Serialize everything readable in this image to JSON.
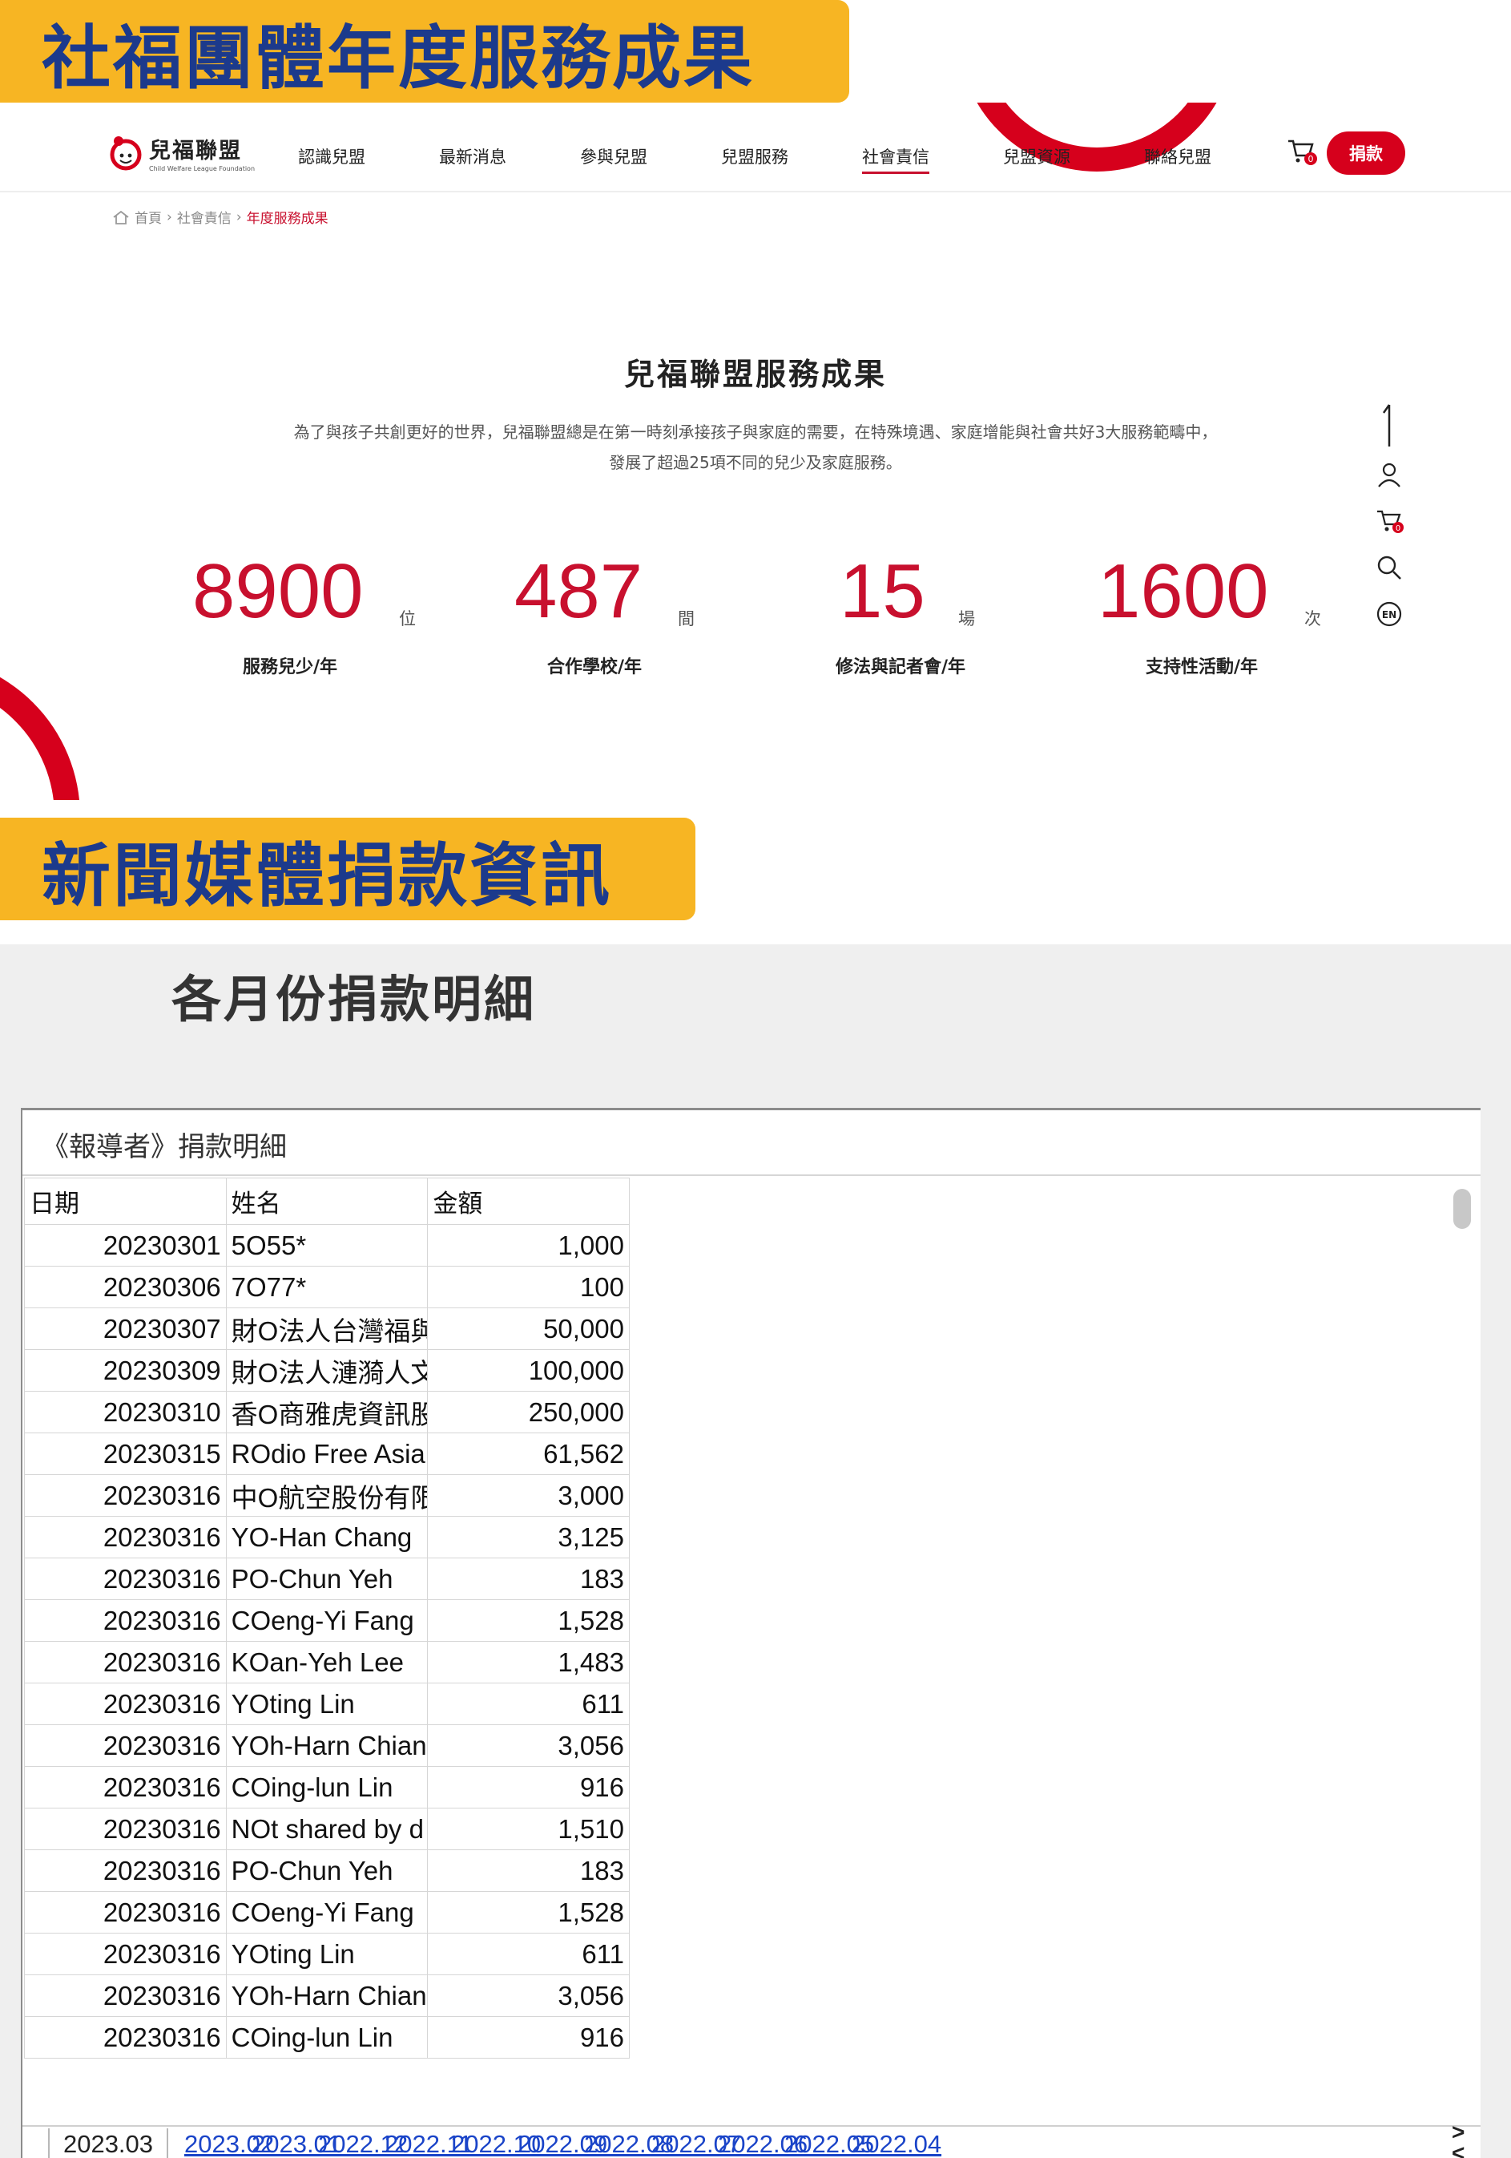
{
  "banners": {
    "top": "社福團體年度服務成果",
    "middle": "新聞媒體捐款資訊"
  },
  "site": {
    "logo": {
      "name": "兒福聯盟",
      "subtitle": "Child Welfare League Foundation"
    },
    "nav": [
      "認識兒盟",
      "最新消息",
      "參與兒盟",
      "兒盟服務",
      "社會責信",
      "兒盟資源",
      "聯絡兒盟"
    ],
    "nav_active": "社會責信",
    "cart_count": "0",
    "donate_label": "捐款",
    "breadcrumb": {
      "home": "首頁",
      "parent": "社會責信",
      "current": "年度服務成果",
      "separator": "›"
    },
    "section_title": "兒福聯盟服務成果",
    "section_desc_line1": "為了與孩子共創更好的世界，兒福聯盟總是在第一時刻承接孩子與家庭的需要，在特殊境遇、家庭增能與社會共好3大服務範疇中，",
    "section_desc_line2": "發展了超過25項不同的兒少及家庭服務。",
    "stats": [
      {
        "value": "8900",
        "unit": "位",
        "label": "服務兒少/年"
      },
      {
        "value": "487",
        "unit": "間",
        "label": "合作學校/年"
      },
      {
        "value": "15",
        "unit": "場",
        "label": "修法與記者會/年"
      },
      {
        "value": "1600",
        "unit": "次",
        "label": "支持性活動/年"
      }
    ],
    "side_icons": [
      "arrow-up-icon",
      "user-icon",
      "cart-icon",
      "search-icon",
      "language-en-icon"
    ],
    "side_cart_count": "0",
    "lang_label": "EN"
  },
  "spreadsheet": {
    "heading": "各月份捐款明細",
    "title": "《報導者》捐款明細",
    "columns": [
      "日期",
      "姓名",
      "金額"
    ],
    "rows": [
      [
        "20230301",
        "5O55*",
        "1,000"
      ],
      [
        "20230306",
        "7O77*",
        "100"
      ],
      [
        "20230307",
        "財O法人台灣福與",
        "50,000"
      ],
      [
        "20230309",
        "財O法人漣漪人文",
        "100,000"
      ],
      [
        "20230310",
        "香O商雅虎資訊股",
        "250,000"
      ],
      [
        "20230315",
        "ROdio Free Asia",
        "61,562"
      ],
      [
        "20230316",
        "中O航空股份有限",
        "3,000"
      ],
      [
        "20230316",
        "YO-Han Chang",
        "3,125"
      ],
      [
        "20230316",
        "PO-Chun Yeh",
        "183"
      ],
      [
        "20230316",
        "COeng-Yi Fang",
        "1,528"
      ],
      [
        "20230316",
        "KOan-Yeh Lee",
        "1,483"
      ],
      [
        "20230316",
        "YOting Lin",
        "611"
      ],
      [
        "20230316",
        "YOh-Harn Chiang",
        "3,056"
      ],
      [
        "20230316",
        "COing-lun Lin",
        "916"
      ],
      [
        "20230316",
        "NOt shared by d",
        "1,510"
      ],
      [
        "20230316",
        "PO-Chun Yeh",
        "183"
      ],
      [
        "20230316",
        "COeng-Yi Fang",
        "1,528"
      ],
      [
        "20230316",
        "YOting Lin",
        "611"
      ],
      [
        "20230316",
        "YOh-Harn Chiang",
        "3,056"
      ],
      [
        "20230316",
        "COing-lun Lin",
        "916"
      ]
    ],
    "sheet_tabs": [
      "2023.03",
      "2023.02",
      "2023.01",
      "2022.12",
      "2022.11",
      "2022.10",
      "2022.09",
      "2022.08",
      "2022.07",
      "2022.06",
      "2022.05",
      "2022.04"
    ],
    "active_tab": "2023.03",
    "tab_next": ">",
    "tab_prev": "<"
  },
  "colors": {
    "brand_red": "#d6001c",
    "banner_yellow": "#f7b523",
    "banner_text": "#1c3a8c",
    "link_blue": "#1a44c8"
  }
}
